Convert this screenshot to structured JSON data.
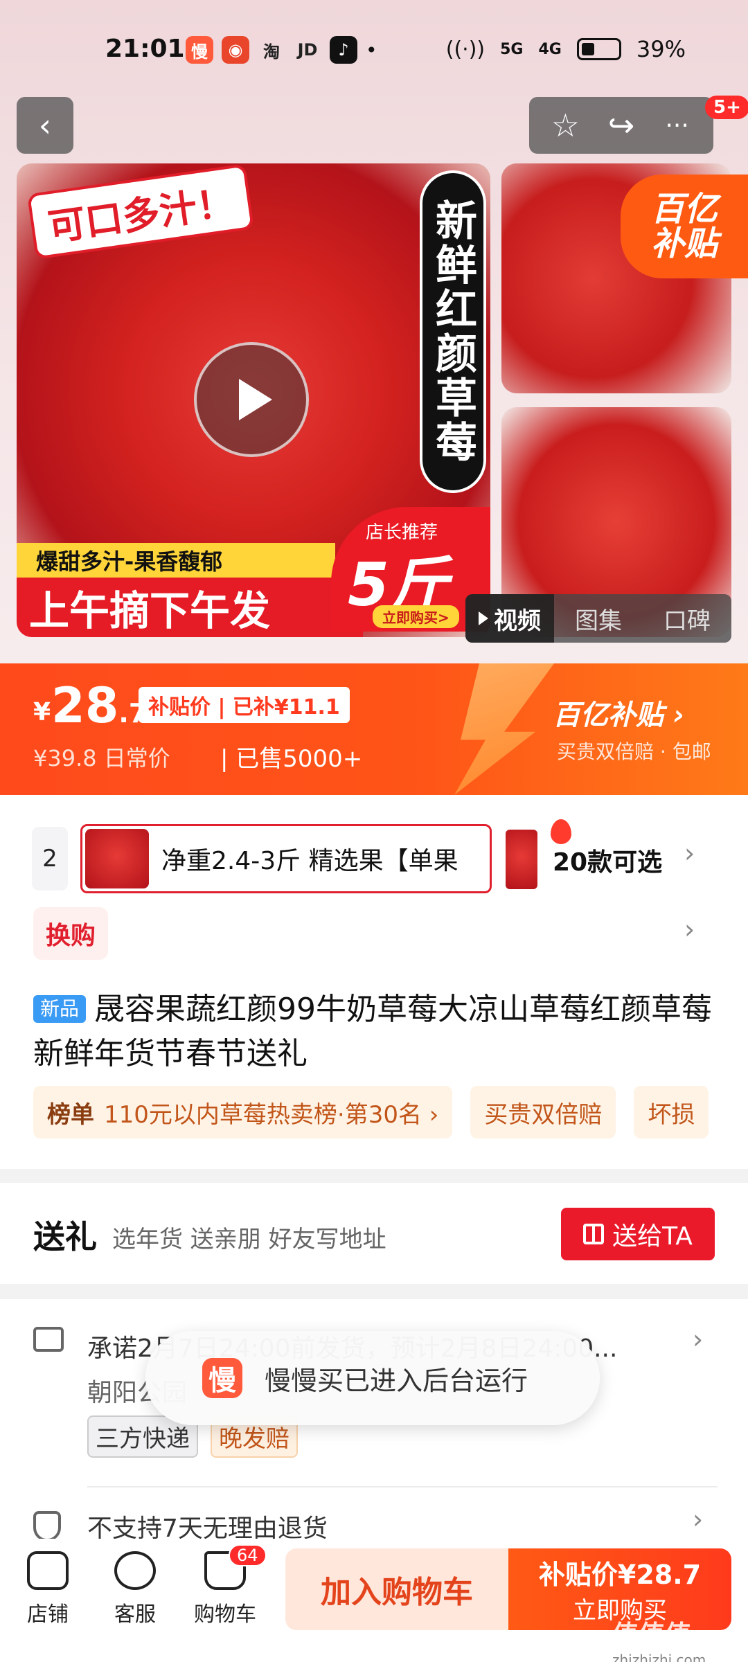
{
  "status_bar": {
    "time": "21:01",
    "apps": [
      {
        "glyph": "慢",
        "color": "#ff5a3c"
      },
      {
        "glyph": "◉",
        "color": "#e8452b"
      },
      {
        "glyph": "淘",
        "color": "#222222"
      },
      {
        "glyph": "JD",
        "color": "#222222"
      },
      {
        "glyph": "♪",
        "color": "#111111"
      }
    ],
    "dot": "•",
    "wifi": "wifi",
    "sig1": "5G",
    "sig2": "4G",
    "battery": "39%"
  },
  "nav": {
    "back": "‹",
    "favorite": "☆",
    "share": "↪",
    "more": "···",
    "badge": "5+"
  },
  "media": {
    "sticker": "可口多汁！",
    "vertical_tag": "新鲜红颜草莓",
    "band_yellow": "爆甜多汁-果香馥郁",
    "band_red": "上午摘下午发",
    "badge_top": "店长推荐",
    "badge_big": "5斤",
    "badge_btn": "立即购买>",
    "subsidy_line1": "百亿",
    "subsidy_line2": "补贴",
    "tabs": [
      "视频",
      "图集",
      "口碑"
    ]
  },
  "price": {
    "currency": "¥",
    "main": "28",
    "decimal": ".7",
    "tag": "补贴价 | 已补¥11.1",
    "old": "¥39.8 日常价",
    "sold": "| 已售5000+",
    "sub_title": "百亿补贴 ›",
    "sub_desc": "买贵双倍赔 · 包邮"
  },
  "sku": {
    "peek": "2",
    "selected": "净重2.4-3斤 精选果【单果",
    "count": "20款可选"
  },
  "swap": "换购",
  "product": {
    "new_tag": "新品",
    "title": "晟容果蔬红颜99牛奶草莓大凉山草莓红颜草莓新鲜年货节春节送礼"
  },
  "chips": [
    {
      "label": "榜单",
      "text": "110元以内草莓热卖榜·第30名 ›"
    },
    {
      "label": "",
      "text": "买贵双倍赔"
    },
    {
      "label": "",
      "text": "坏损"
    }
  ],
  "gift": {
    "title": "送礼",
    "desc": "选年货 送亲朋 好友写地址",
    "button": "送给TA"
  },
  "shipping": {
    "line1": "承诺2月7日24:00前发货，预计2月8日24:00...",
    "line2": "朝阳公园",
    "tag1": "三方快递",
    "tag2": "晚发赔",
    "returns": "不支持7天无理由退货"
  },
  "toast": {
    "icon": "慢",
    "text": "慢慢买已进入后台运行"
  },
  "bottom": {
    "shop": "店铺",
    "service": "客服",
    "cart": "购物车",
    "cart_badge": "64",
    "add_cart": "加入购物车",
    "buy_price": "补贴价¥28.7",
    "buy_now": "立即购买"
  },
  "watermark": {
    "logo": "值值值",
    "url": "zhizhizhi.com"
  },
  "colors": {
    "accent": "#ff4a1c",
    "brand_red": "#ea1a2b",
    "new_tag": "#3a9bf5"
  }
}
